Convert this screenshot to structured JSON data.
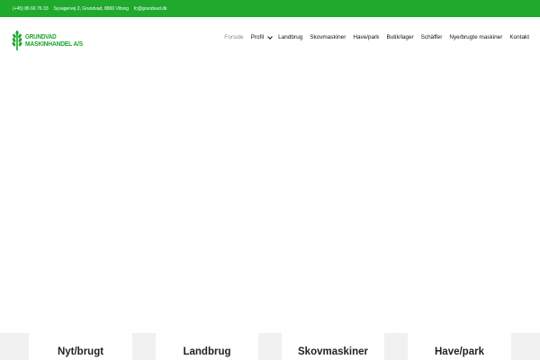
{
  "topbar": {
    "phone": "(+45) 86 66 76 33",
    "address": "Syvagervej 2, Grundvad, 8800 Viborg",
    "email": "fc@grundvad.dk"
  },
  "logo": {
    "line1": "GRUNDVAD",
    "line2": "MASKINHANDEL A/S"
  },
  "nav": {
    "items": [
      {
        "label": "Forside",
        "active": true
      },
      {
        "label": "Profil",
        "has_dropdown": true
      },
      {
        "label": "Landbrug"
      },
      {
        "label": "Skovmaskiner"
      },
      {
        "label": "Have/park"
      },
      {
        "label": "Butik/lager"
      },
      {
        "label": "Schäffer"
      },
      {
        "label": "Nye/brugte maskiner"
      },
      {
        "label": "Kontakt"
      }
    ]
  },
  "cards": [
    {
      "label": "Nyt/brugt"
    },
    {
      "label": "Landbrug"
    },
    {
      "label": "Skovmaskiner"
    },
    {
      "label": "Have/park"
    }
  ],
  "colors": {
    "brand_green": "#1faa2e",
    "card_bg": "#f1f1f1"
  }
}
